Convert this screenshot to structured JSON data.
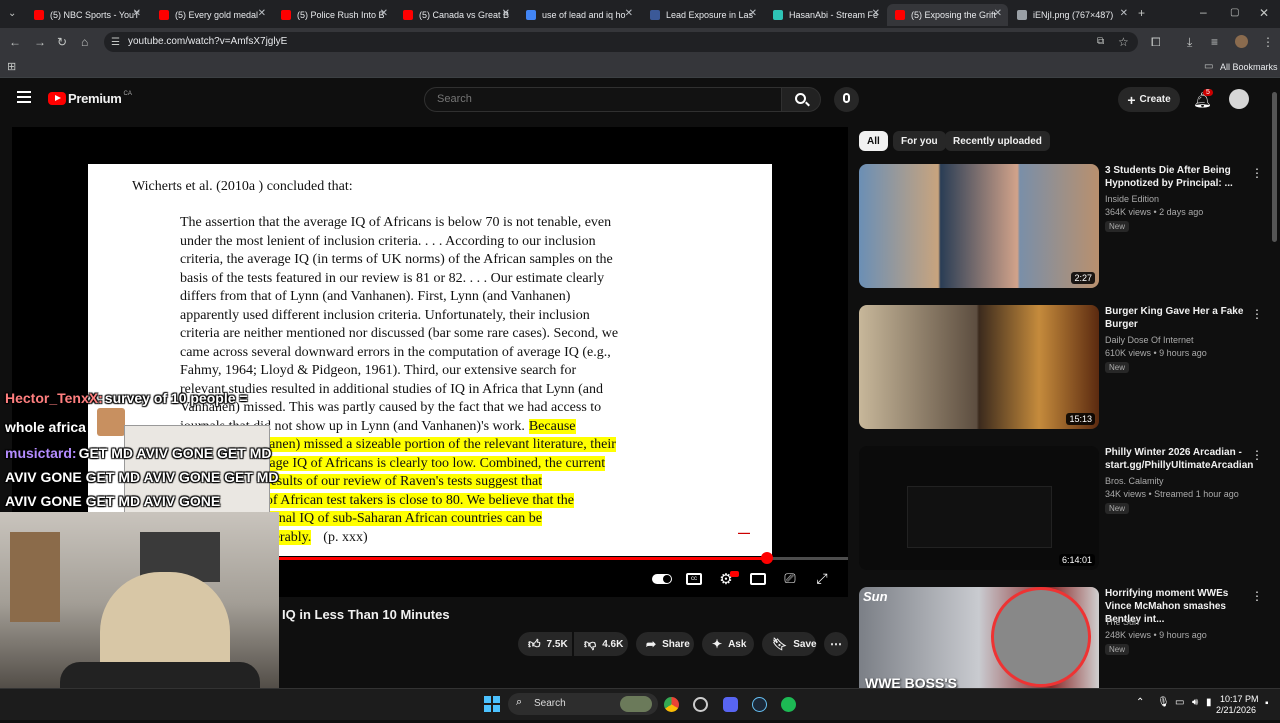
{
  "browser": {
    "tabs": [
      {
        "title": "(5) NBC Sports - YouT",
        "color": "#ff0000"
      },
      {
        "title": "(5) Every gold medal",
        "color": "#ff0000"
      },
      {
        "title": "(5) Police Rush Into B",
        "color": "#ff0000"
      },
      {
        "title": "(5) Canada vs Great B",
        "color": "#ff0000"
      },
      {
        "title": "use of lead and iq ho",
        "color": "#4285f4"
      },
      {
        "title": "Lead Exposure in Las",
        "color": "#3b5998"
      },
      {
        "title": "HasanAbi - Stream Fe",
        "color": "#2ec4b6"
      },
      {
        "title": "(5) Exposing the Grift",
        "color": "#ff0000"
      },
      {
        "title": "iENjI.png (767×487)",
        "color": "#9aa0a6"
      }
    ],
    "url": "youtube.com/watch?v=AmfsX7jglyE",
    "all_bookmarks": "All Bookmarks"
  },
  "youtube": {
    "logo_text": "Premium",
    "logo_region": "CA",
    "search_placeholder": "Search",
    "create_label": "Create",
    "notif_count": "5"
  },
  "slide": {
    "intro": "Wicherts et al. (2010a ) concluded that:",
    "lines": [
      "The assertion that the average IQ of Africans is below 70 is not tenable, even",
      "under the most lenient of inclusion criteria. . . . According to our inclusion",
      "criteria, the average IQ (in terms of UK norms) of the African samples on the",
      "basis of the tests featured in our review is 81 or 82. . . . Our estimate clearly",
      "differs from that of Lynn (and Vanhanen). First, Lynn (and Vanhanen)",
      "apparently used different inclusion criteria. Unfortunately, their inclusion",
      "criteria are neither mentioned nor discussed (bar some rare cases). Second, we",
      "came across several downward errors in the computation of average IQ (e.g.,",
      "Fahmy, 1964; Lloyd & Pidgeon, 1961). Third, our extensive search for",
      "relevant studies resulted in additional studies of IQ in Africa that Lynn (and",
      "Vanhanen) missed. This was partly caused by the fact that we had access to",
      "journals that did not show up in Lynn (and Vanhanen)'s work."
    ],
    "hl_inline": "Because",
    "hl_lines": [
      "Lynn (and Vanhanen) missed a sizeable portion of the relevant literature, their",
      "estimate of average IQ of Africans is clearly too low. Combined, the current",
      "review and the results of our review of Raven's tests suggest that",
      "the average IQ of African test takers is close to 80. We believe that the",
      "estimates of national IQ of sub-Saharan African countries can be",
      "improved considerably."
    ],
    "cite": "(p. xxx)"
  },
  "player": {
    "progress": 0.903,
    "title": "IQ in Less Than 10 Minutes",
    "likes": "7.5K",
    "dislikes": "4.6K",
    "share": "Share",
    "ask": "Ask",
    "save": "Save"
  },
  "chips": [
    "All",
    "For you",
    "Recently uploaded"
  ],
  "recommendations": [
    {
      "title": "3 Students Die After Being Hypnotized by Principal: ...",
      "channel": "Inside Edition",
      "meta": "364K views • 2 days ago",
      "badge": "New",
      "duration": "2:27"
    },
    {
      "title": "Burger King Gave Her a Fake Burger",
      "channel": "Daily Dose Of Internet",
      "meta": "610K views • 9 hours ago",
      "badge": "New",
      "duration": "15:13"
    },
    {
      "title": "Philly Winter 2026 Arcadian - start.gg/PhillyUltimateArcadian",
      "channel": "Bros. Calamity",
      "meta": "34K views • Streamed 1 hour ago",
      "badge": "New",
      "duration": "6:14:01"
    },
    {
      "title": "Horrifying moment WWEs Vince McMahon smashes Bentley int...",
      "channel": "The Sun",
      "meta": "248K views • 9 hours ago",
      "badge": "New",
      "duration": ""
    }
  ],
  "thumb_text": {
    "sun": "Sun",
    "wwe": "WWE BOSS'S"
  },
  "chat": [
    {
      "user": "Hector_TenxX:",
      "user_color": "#ff7f7f",
      "text": "survey of 10 people ="
    },
    {
      "user": "",
      "user_color": "#ffffff",
      "text": "whole africa"
    },
    {
      "user": "musictard:",
      "user_color": "#b48cff",
      "text": "GET MD AVIV GONE GET MD"
    },
    {
      "user": "",
      "user_color": "#ffffff",
      "text": "AVIV GONE GET MD AVIV GONE GET MD"
    },
    {
      "user": "",
      "user_color": "#ffffff",
      "text": "AVIV GONE GET MD AVIV GONE"
    }
  ],
  "taskbar": {
    "search": "Search",
    "time": "10:17 PM",
    "date": "2/21/2026"
  }
}
